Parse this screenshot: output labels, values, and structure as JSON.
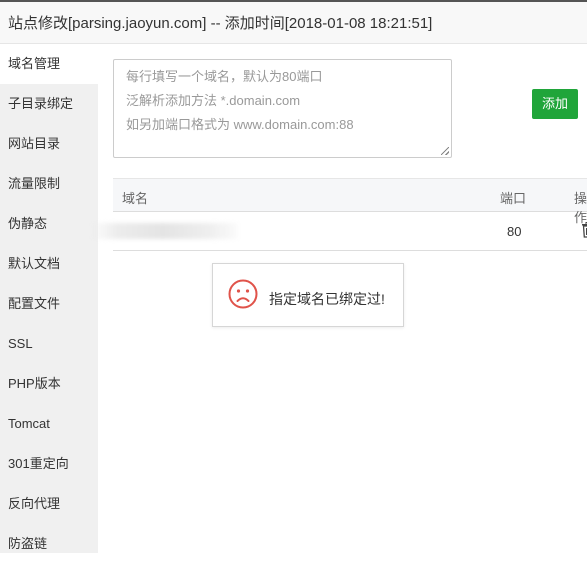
{
  "window": {
    "title": "站点修改[parsing.jaoyun.com] -- 添加时间[2018-01-08 18:21:51]"
  },
  "sidebar": {
    "items": [
      {
        "label": "域名管理"
      },
      {
        "label": "子目录绑定"
      },
      {
        "label": "网站目录"
      },
      {
        "label": "流量限制"
      },
      {
        "label": "伪静态"
      },
      {
        "label": "默认文档"
      },
      {
        "label": "配置文件"
      },
      {
        "label": "SSL"
      },
      {
        "label": "PHP版本"
      },
      {
        "label": "Tomcat"
      },
      {
        "label": "301重定向"
      },
      {
        "label": "反向代理"
      },
      {
        "label": "防盗链"
      }
    ]
  },
  "domain_input": {
    "placeholder_lines": [
      "每行填写一个域名，默认为80端口",
      "泛解析添加方法 *.domain.com",
      "如另加端口格式为 www.domain.com:88"
    ]
  },
  "add_button": {
    "label": "添加"
  },
  "table": {
    "headers": {
      "domain": "域名",
      "port": "端口",
      "action": "操作"
    },
    "rows": [
      {
        "port": "80"
      }
    ]
  },
  "toast": {
    "message": "指定域名已绑定过!"
  },
  "colors": {
    "accent": "#20a53a",
    "error": "#e0534a"
  }
}
